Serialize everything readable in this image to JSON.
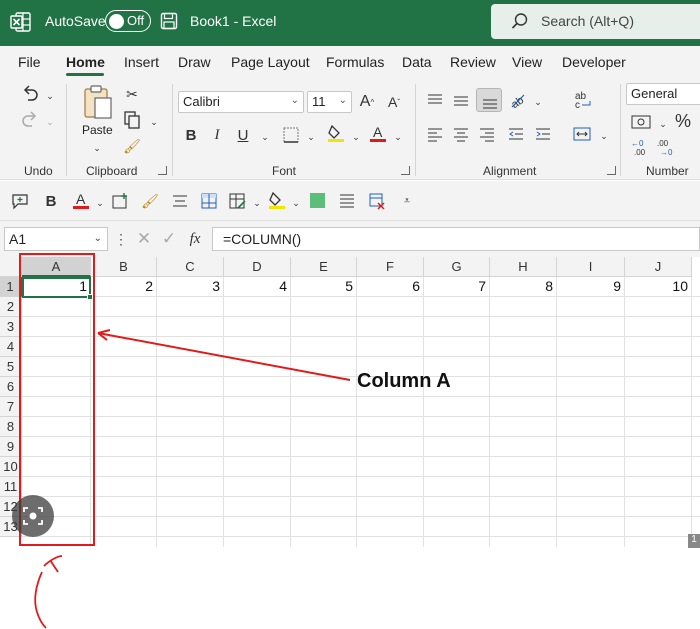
{
  "titlebar": {
    "autosave_label": "AutoSave",
    "autosave_state": "Off",
    "title": "Book1  -  Excel",
    "search_placeholder": "Search (Alt+Q)",
    "brand_color": "#217346"
  },
  "tabs": [
    {
      "label": "File"
    },
    {
      "label": "Home",
      "active": true
    },
    {
      "label": "Insert"
    },
    {
      "label": "Draw"
    },
    {
      "label": "Page Layout"
    },
    {
      "label": "Formulas"
    },
    {
      "label": "Data"
    },
    {
      "label": "Review"
    },
    {
      "label": "View"
    },
    {
      "label": "Developer"
    }
  ],
  "ribbon": {
    "groups": {
      "undo": "Undo",
      "clipboard": "Clipboard",
      "font": "Font",
      "alignment": "Alignment",
      "number": "Number"
    },
    "paste_label": "Paste",
    "font_name": "Calibri",
    "font_size": "11",
    "number_format": "General",
    "bold": "B",
    "italic": "I",
    "underline": "U"
  },
  "qat": {
    "bold": "B"
  },
  "formula_bar": {
    "name_box": "A1",
    "fx": "fx",
    "formula": "=COLUMN()"
  },
  "sheet": {
    "columns": [
      "A",
      "B",
      "C",
      "D",
      "E",
      "F",
      "G",
      "H",
      "I",
      "J"
    ],
    "rows": [
      "1",
      "2",
      "3",
      "4",
      "5",
      "6",
      "7",
      "8",
      "9",
      "10",
      "11",
      "12",
      "13"
    ],
    "row1_values": [
      "1",
      "2",
      "3",
      "4",
      "5",
      "6",
      "7",
      "8",
      "9",
      "10"
    ],
    "selected_column": "A",
    "selected_row": "1"
  },
  "annotation": {
    "label": "Column A",
    "color": "#e11b1b"
  }
}
